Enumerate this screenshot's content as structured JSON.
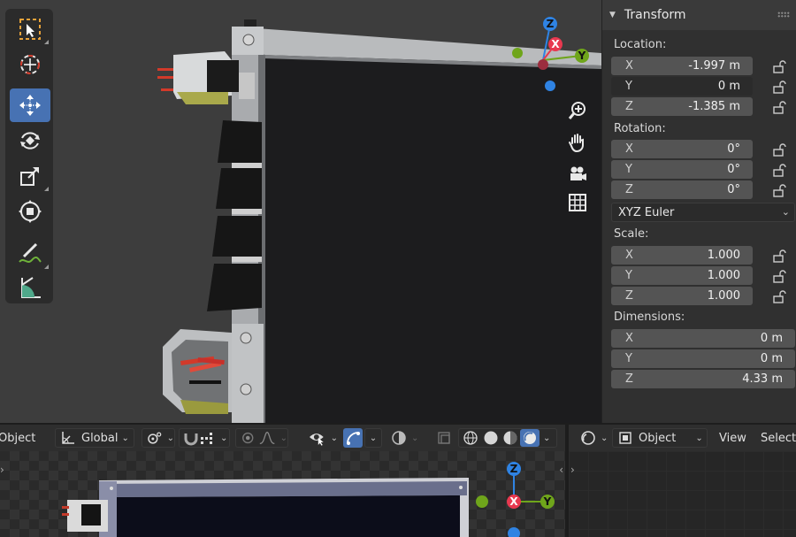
{
  "panel": {
    "title": "Transform",
    "location": {
      "label": "Location:",
      "rows": [
        {
          "axis": "X",
          "value": "-1.997 m"
        },
        {
          "axis": "Y",
          "value": "0 m"
        },
        {
          "axis": "Z",
          "value": "-1.385 m"
        }
      ]
    },
    "rotation": {
      "label": "Rotation:",
      "rows": [
        {
          "axis": "X",
          "value": "0°"
        },
        {
          "axis": "Y",
          "value": "0°"
        },
        {
          "axis": "Z",
          "value": "0°"
        }
      ]
    },
    "rotation_mode": "XYZ Euler",
    "scale": {
      "label": "Scale:",
      "rows": [
        {
          "axis": "X",
          "value": "1.000"
        },
        {
          "axis": "Y",
          "value": "1.000"
        },
        {
          "axis": "Z",
          "value": "1.000"
        }
      ]
    },
    "dimensions": {
      "label": "Dimensions:",
      "rows": [
        {
          "axis": "X",
          "value": "0 m"
        },
        {
          "axis": "Y",
          "value": "0 m"
        },
        {
          "axis": "Z",
          "value": "4.33 m"
        }
      ]
    }
  },
  "gizmo": {
    "x": "X",
    "y": "Y",
    "z": "Z"
  },
  "header": {
    "mode_label": "Object",
    "orientation": "Global",
    "right_mode": "Object",
    "view_menu": "View",
    "select_menu": "Select"
  },
  "colors": {
    "accent": "#4772b3",
    "axis_x": "#e8384f",
    "axis_y": "#6fa51b",
    "axis_z": "#2f83e3"
  },
  "icons": {
    "tools": [
      "select-box-icon",
      "cursor-icon",
      "move-icon",
      "rotate-icon",
      "scale-icon",
      "transform-icon",
      "annotate-icon",
      "measure-icon"
    ],
    "nav": [
      "zoom-icon",
      "pan-hand-icon",
      "camera-icon",
      "grid-icon"
    ]
  }
}
